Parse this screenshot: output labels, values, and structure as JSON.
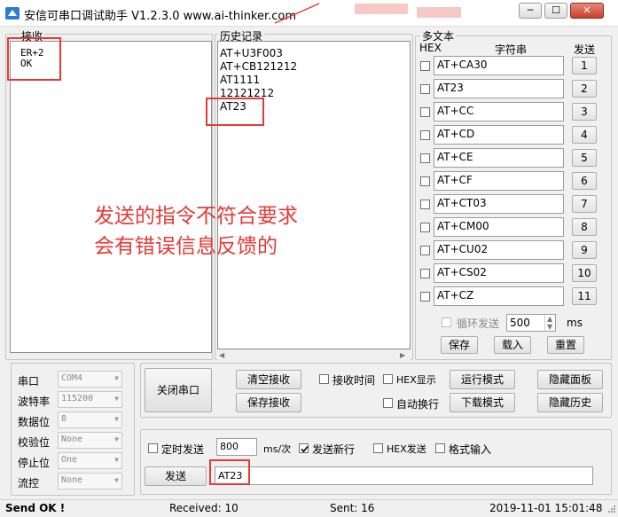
{
  "window": {
    "title": "安信可串口调试助手 V1.2.3.0    www.ai-thinker.com",
    "minimize": "─",
    "maximize": "☐",
    "close": "✕"
  },
  "receive": {
    "label": "接收",
    "lines": [
      "ER+2",
      "OK"
    ]
  },
  "history": {
    "label": "历史记录",
    "lines": [
      "AT+U3F003",
      "AT+CB121212",
      "AT1111",
      "12121212",
      "AT23"
    ]
  },
  "multitext": {
    "label": "多文本",
    "col_hex": "HEX",
    "col_string": "字符串",
    "col_send": "发送",
    "rows": [
      {
        "value": "AT+CA30",
        "btn": "1"
      },
      {
        "value": "AT23",
        "btn": "2"
      },
      {
        "value": "AT+CC",
        "btn": "3"
      },
      {
        "value": "AT+CD",
        "btn": "4"
      },
      {
        "value": "AT+CE",
        "btn": "5"
      },
      {
        "value": "AT+CF",
        "btn": "6"
      },
      {
        "value": "AT+CT03",
        "btn": "7"
      },
      {
        "value": "AT+CM00",
        "btn": "8"
      },
      {
        "value": "AT+CU02",
        "btn": "9"
      },
      {
        "value": "AT+CS02",
        "btn": "10"
      },
      {
        "value": "AT+CZ",
        "btn": "11"
      }
    ],
    "loop_label": "循环发送",
    "loop_value": "500",
    "loop_unit": "ms",
    "save": "保存",
    "load": "载入",
    "reset": "重置"
  },
  "annotation": {
    "line1": "发送的指令不符合要求",
    "line2": "会有错误信息反馈的"
  },
  "port": {
    "labels": [
      "串口",
      "波特率",
      "数据位",
      "校验位",
      "停止位",
      "流控"
    ],
    "values": [
      "COM4",
      "115200",
      "8",
      "None",
      "One",
      "None"
    ]
  },
  "controls": {
    "close_port": "关闭串口",
    "clear_receive": "清空接收",
    "save_receive": "保存接收",
    "receive_time": "接收时间",
    "hex_display": "HEX显示",
    "auto_wrap": "自动换行",
    "run_mode": "运行模式",
    "download_mode": "下载模式",
    "hide_panel": "隐藏面板",
    "hide_history": "隐藏历史"
  },
  "send": {
    "timed_label": "定时发送",
    "timed_value": "800",
    "timed_unit": "ms/次",
    "newline_label": "发送新行",
    "hex_send": "HEX发送",
    "format_input": "格式输入",
    "send_button": "发送",
    "input_value": "AT23"
  },
  "status": {
    "state": "Send OK !",
    "received": "Received: 10",
    "sent": "Sent: 16",
    "datetime": "2019-11-01 15:01:48"
  }
}
